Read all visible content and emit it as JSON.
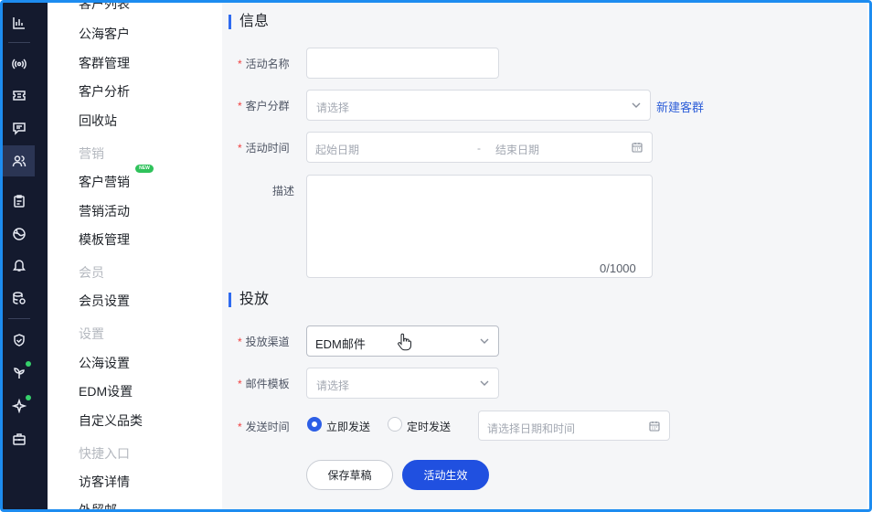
{
  "sidebar_icons": [
    "bar-chart-icon",
    "broadcast-icon",
    "ticket-icon",
    "message-icon",
    "users-icon",
    "clipboard-icon",
    "globe-icon",
    "bell-icon",
    "database-icon",
    "shield-icon",
    "sprout-icon",
    "sparkle-icon",
    "toolbox-icon"
  ],
  "menu": {
    "top_cut": "客户列表",
    "items": [
      {
        "label": "公海客户"
      },
      {
        "label": "客群管理"
      },
      {
        "label": "客户分析"
      },
      {
        "label": "回收站"
      }
    ],
    "group_marketing": "营销",
    "marketing_items": [
      {
        "label": "客户营销",
        "badge": "NEW"
      },
      {
        "label": "营销活动"
      },
      {
        "label": "模板管理"
      }
    ],
    "group_member": "会员",
    "member_items": [
      {
        "label": "会员设置"
      }
    ],
    "group_settings": "设置",
    "settings_items": [
      {
        "label": "公海设置"
      },
      {
        "label": "EDM设置"
      },
      {
        "label": "自定义品类"
      }
    ],
    "group_shortcuts": "快捷入口",
    "shortcut_items": [
      {
        "label": "访客详情"
      }
    ],
    "bottom_cut": "外贸邮"
  },
  "form": {
    "section_info": "信息",
    "activity_name_label": "活动名称",
    "activity_name_value": "",
    "segment_label": "客户分群",
    "segment_placeholder": "请选择",
    "new_segment_link": "新建客群",
    "time_label": "活动时间",
    "start_placeholder": "起始日期",
    "range_sep": "-",
    "end_placeholder": "结束日期",
    "desc_label": "描述",
    "desc_counter": "0/1000",
    "section_delivery": "投放",
    "channel_label": "投放渠道",
    "channel_value": "EDM邮件",
    "template_label": "邮件模板",
    "template_placeholder": "请选择",
    "send_time_label": "发送时间",
    "radio_now": "立即发送",
    "radio_scheduled": "定时发送",
    "datetime_placeholder": "请选择日期和时间",
    "save_draft": "保存草稿",
    "activate": "活动生效",
    "required_mark": "*"
  },
  "colors": {
    "accent": "#2050e0",
    "rail": "#141a2e",
    "frame": "#1d8cf0"
  }
}
